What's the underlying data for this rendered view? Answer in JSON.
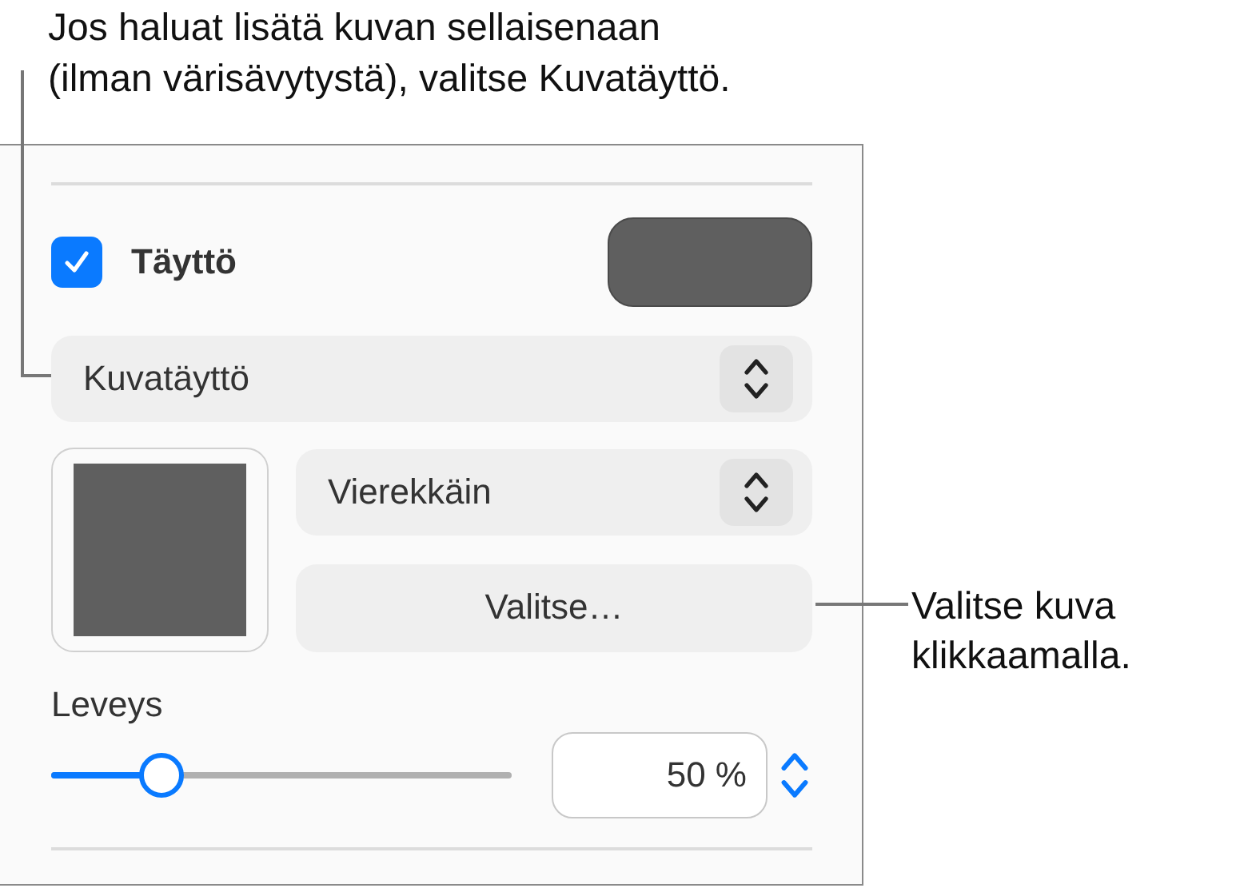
{
  "callouts": [
    {
      "text": "Jos haluat lisätä kuvan sellaisenaan\n(ilman värisävytystä), valitse Kuvatäyttö."
    },
    {
      "text": "Valitse kuva\nklikkaamalla."
    }
  ],
  "fill": {
    "label": "Täyttö",
    "checked": true
  },
  "fill_type": {
    "value": "Kuvatäyttö"
  },
  "scaling": {
    "value": "Vierekkäin"
  },
  "choose_button": {
    "label": "Valitse…"
  },
  "width": {
    "label": "Leveys",
    "level": 0.24,
    "value": "50 %"
  }
}
